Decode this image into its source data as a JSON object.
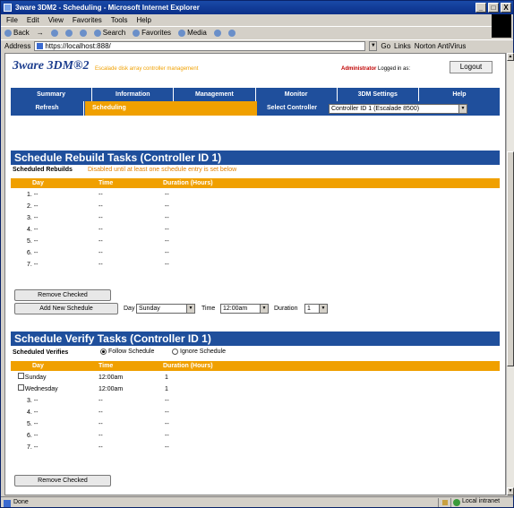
{
  "window": {
    "title": "3ware 3DM2 - Scheduling - Microsoft Internet Explorer",
    "buttons": [
      "_",
      "□",
      "X"
    ]
  },
  "menubar": [
    "File",
    "Edit",
    "View",
    "Favorites",
    "Tools",
    "Help"
  ],
  "toolbar": {
    "back": "Back",
    "forward": "→",
    "search": "Search",
    "favorites": "Favorites",
    "media": "Media"
  },
  "address": {
    "label": "Address",
    "value": "https://localhost:888/",
    "go": "Go",
    "links": "Links",
    "norton": "Norton AntiVirus"
  },
  "header": {
    "logo": "3ware 3DM®2",
    "tagline": "Escalade disk array controller management",
    "logged_in_prefix": "Logged in as:",
    "user": "Administrator",
    "logout": "Logout"
  },
  "nav": {
    "top": [
      "Summary",
      "Information",
      "Management",
      "Monitor",
      "3DM Settings",
      "Help"
    ],
    "refresh": "Refresh",
    "scheduling": "Scheduling",
    "select_controller": "Select Controller",
    "controller_value": "Controller ID 1 (Escalade 8500)"
  },
  "rebuild": {
    "title": "Schedule Rebuild Tasks (Controller ID 1)",
    "label": "Scheduled Rebuilds",
    "note": "Disabled until at least one schedule entry is set below",
    "columns": [
      "Day",
      "Time",
      "Duration (Hours)"
    ],
    "rows": [
      {
        "day": "1. --",
        "time": "--",
        "dur": "--"
      },
      {
        "day": "2. --",
        "time": "--",
        "dur": "--"
      },
      {
        "day": "3. --",
        "time": "--",
        "dur": "--"
      },
      {
        "day": "4. --",
        "time": "--",
        "dur": "--"
      },
      {
        "day": "5. --",
        "time": "--",
        "dur": "--"
      },
      {
        "day": "6. --",
        "time": "--",
        "dur": "--"
      },
      {
        "day": "7. --",
        "time": "--",
        "dur": "--"
      }
    ],
    "remove_btn": "Remove Checked",
    "add_btn": "Add New Schedule",
    "day_label": "Day",
    "day_value": "Sunday",
    "time_label": "Time",
    "time_value": "12:00am",
    "duration_label": "Duration",
    "duration_value": "1"
  },
  "verify": {
    "title": "Schedule Verify Tasks (Controller ID 1)",
    "label": "Scheduled Verifies",
    "follow": "Follow Schedule",
    "ignore": "Ignore Schedule",
    "columns": [
      "Day",
      "Time",
      "Duration (Hours)"
    ],
    "rows": [
      {
        "day": "1. Sunday",
        "time": "12:00am",
        "dur": "1",
        "check": true
      },
      {
        "day": "2. Wednesday",
        "time": "12:00am",
        "dur": "1",
        "check": true
      },
      {
        "day": "3. --",
        "time": "--",
        "dur": "--"
      },
      {
        "day": "4. --",
        "time": "--",
        "dur": "--"
      },
      {
        "day": "5. --",
        "time": "--",
        "dur": "--"
      },
      {
        "day": "6. --",
        "time": "--",
        "dur": "--"
      },
      {
        "day": "7. --",
        "time": "--",
        "dur": "--"
      }
    ],
    "remove_btn": "Remove Checked"
  },
  "status": {
    "text": "Done",
    "zone": "Local intranet"
  },
  "colors": {
    "nav_blue": "#1f4f9c",
    "accent_orange": "#f0a000"
  }
}
